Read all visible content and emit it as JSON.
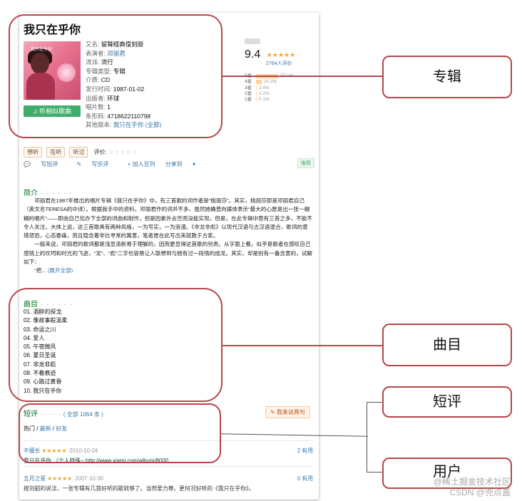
{
  "album": {
    "title": "我只在乎你",
    "cover_text": "我只在乎你",
    "listen_label": "♫ 听相似歌曲",
    "info": [
      {
        "k": "又名:",
        "v": "留聲經典復刻版",
        "link": false
      },
      {
        "k": "表演者:",
        "v": "邓丽君",
        "link": true
      },
      {
        "k": "流派:",
        "v": "流行",
        "link": false
      },
      {
        "k": "专辑类型:",
        "v": "专辑",
        "link": false
      },
      {
        "k": "介质:",
        "v": "CD",
        "link": false
      },
      {
        "k": "发行时间:",
        "v": "1987-01-02",
        "link": false
      },
      {
        "k": "出版者:",
        "v": "环球",
        "link": false
      },
      {
        "k": "唱片数:",
        "v": "1",
        "link": false
      },
      {
        "k": "条形码:",
        "v": "4718622110798",
        "link": false
      }
    ],
    "other_version_label": "其他版本:",
    "other_version_value": "我只在乎你",
    "other_version_all": "(全部)"
  },
  "rating": {
    "score": "9.4",
    "stars": "★★★★★",
    "votes": "2764人评价",
    "distribution": [
      {
        "label": "5星",
        "pct_text": "77.1%",
        "pct": 0.771
      },
      {
        "label": "4星",
        "pct_text": "20.3%",
        "pct": 0.203
      },
      {
        "label": "3星",
        "pct_text": "2.4%",
        "pct": 0.024
      },
      {
        "label": "2星",
        "pct_text": "0.2%",
        "pct": 0.002
      },
      {
        "label": "1星",
        "pct_text": "0.1%",
        "pct": 0.001
      }
    ]
  },
  "actions": {
    "want": "想听",
    "listening": "在听",
    "listened": "听过",
    "evaluate": "评价:",
    "empty_stars": "☆☆☆☆☆",
    "write_short": "写短评",
    "write_review": "写乐评",
    "add_doulist": "+ 加入豆列",
    "share": "分享到",
    "recommend": "推荐"
  },
  "intro": {
    "heading": "简介",
    "dots": "· · · · · ·",
    "p1": "邓丽君在1987年推出的唱片专辑《我只在乎你》中，有三首歌的词作者是“桃丽莎”。其实，桃丽莎即是邓丽君自己（英文名TERESA的中译）。根据我手中的资料，邓丽君作的词并不多，虽然她确曾向媒体表示“最大的心愿是出一张一糊糊的唱片”——即由自己包办下全部的词曲和制作，但是因素外去世而没能实现。但是，在此专辑中竟有三首之多，不能不令人关注。大体上说，这三首歌具有两种风格，一为写实，一为浪漫。《非龙非彪》以现代汉语与古汉语混合，歌词的意境悲恐，心态泰痛，而且隐含着非比寻常的寓意，笔者愿在此写出来就教于方家。",
    "p2": "一般来说，邓丽君的歌词都是浅显清新易于理解的，因而更显得这首歌的另类。从字面上看，似乎是歌者在感叹自己感情上的坎坷和时光的飞逝，“龙”、“彪”二字也容易让人联想到与她有过一段情的成龙。其实，却是别有一番含意的，试解如下：",
    "p3": "“把...",
    "expand": "(展开全部)"
  },
  "tracks": {
    "heading": "曲目",
    "dots": "· · · · · ·",
    "items": [
      "01. 酒醉的探戈",
      "02. 像故事般温柔",
      "03. 命运之川",
      "04. 爱人",
      "05. 午夜微风",
      "06. 夏日圣诞",
      "07. 非龙非彪",
      "08. 不着痕迹",
      "09. 心路过黄昏",
      "10. 我只在乎你"
    ]
  },
  "short_comments": {
    "heading": "短评",
    "dots": "· · · · · ·",
    "total": "( 全部 1064 条 )",
    "write_btn": "✎ 我来说两句",
    "filter_hot": "热门",
    "filter_sep": " / ",
    "filter_new": "最新",
    "filter_friends": "好友",
    "items": [
      {
        "user": "不擅长",
        "stars": "★★★★★",
        "date": "2010-10-24",
        "useful": "2 有用",
        "text": "我只在乎你 （个人特殊~ http://www.xiami.com/album/8000"
      },
      {
        "user": "五月之星",
        "stars": "★★★★★",
        "date": "2007-10-30",
        "useful": "0 有用",
        "text": "按刘韶的说法，一张专辑有几首好听的歌就够了。当然爱力尊，更何况好听的《我只在乎你》。"
      }
    ]
  },
  "annotations": {
    "album": "专辑",
    "tracks": "曲目",
    "short": "短评",
    "user": "用户"
  },
  "watermark": {
    "line1": "@稀土掘金技术社区",
    "line2": "CSDN @兜点酱"
  }
}
